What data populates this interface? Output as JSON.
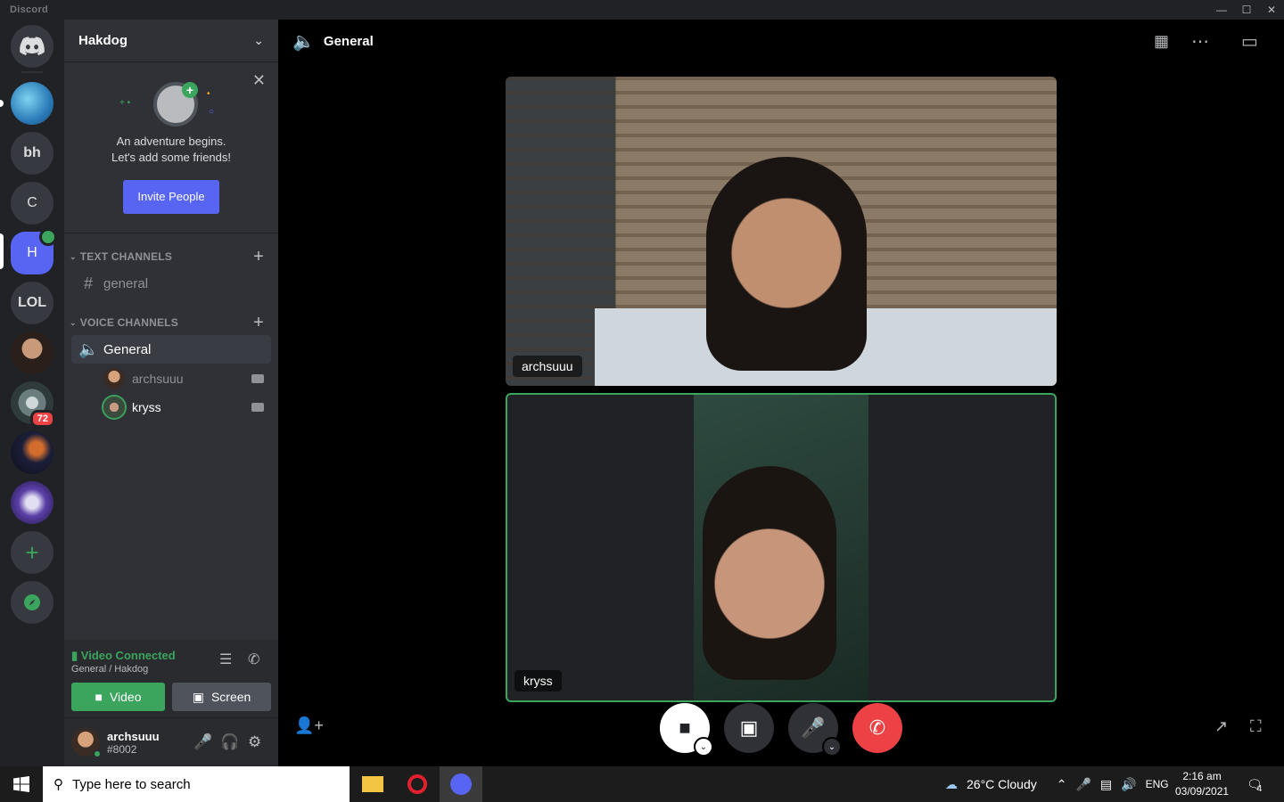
{
  "window": {
    "app_name": "Discord"
  },
  "guilds": {
    "home_label": "Home",
    "items": [
      {
        "initials": "bh"
      },
      {
        "initials": "C"
      },
      {
        "initials": "H"
      },
      {
        "initials": "LOL"
      }
    ],
    "unread_badge": "72"
  },
  "server": {
    "name": "Hakdog"
  },
  "welcome": {
    "line1": "An adventure begins.",
    "line2": "Let's add some friends!",
    "invite_label": "Invite People"
  },
  "text_channels": {
    "header": "TEXT CHANNELS",
    "items": [
      {
        "name": "general"
      }
    ]
  },
  "voice_channels": {
    "header": "VOICE CHANNELS",
    "channel": "General",
    "users": [
      {
        "name": "archsuuu"
      },
      {
        "name": "kryss"
      }
    ]
  },
  "rtc": {
    "status": "Video Connected",
    "location": "General / Hakdog",
    "video_label": "Video",
    "screen_label": "Screen"
  },
  "user": {
    "name": "archsuuu",
    "tag": "#8002"
  },
  "main": {
    "channel_title": "General",
    "tiles": [
      {
        "label": "archsuuu"
      },
      {
        "label": "kryss"
      }
    ]
  },
  "taskbar": {
    "search_placeholder": "Type here to search",
    "weather": "26°C  Cloudy",
    "lang": "ENG",
    "time": "2:16 am",
    "date": "03/09/2021",
    "notification_count": "4"
  },
  "colors": {
    "accent": "#5865f2",
    "green": "#3ba55d",
    "red": "#ed4245"
  }
}
